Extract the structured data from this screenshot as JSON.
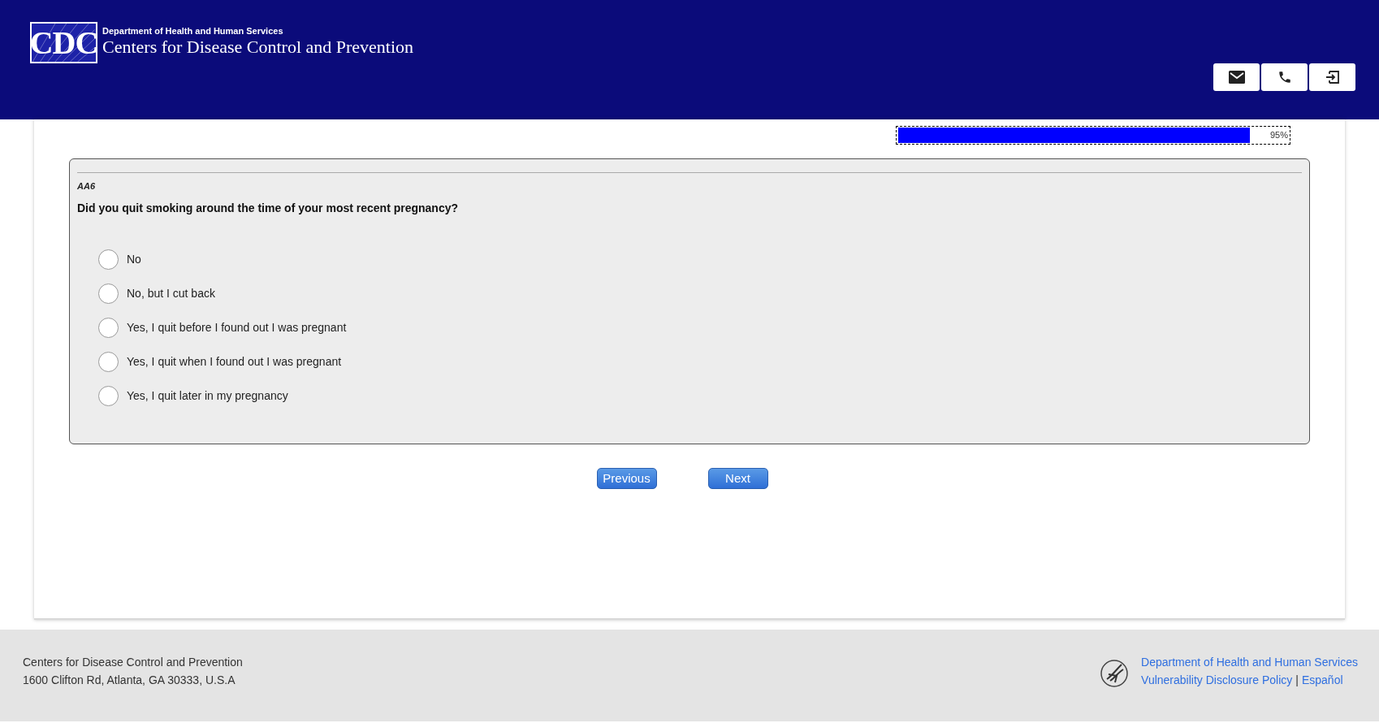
{
  "header": {
    "logo_text": "CDC",
    "department": "Department of Health and Human Services",
    "agency": "Centers for Disease Control and Prevention",
    "actions": [
      {
        "kind": "mail"
      },
      {
        "kind": "phone"
      },
      {
        "kind": "exit"
      }
    ]
  },
  "progress": {
    "level": 0.95,
    "reading": "95%"
  },
  "question": {
    "code": "AA6",
    "text": "Did you quit smoking around the time of your most recent pregnancy?",
    "options": [
      {
        "label": "No",
        "selected": false
      },
      {
        "label": "No, but I cut back",
        "selected": false
      },
      {
        "label": "Yes, I quit before I found out I was pregnant",
        "selected": false
      },
      {
        "label": "Yes, I quit when I found out I was pregnant",
        "selected": false
      },
      {
        "label": "Yes, I quit later in my pregnancy",
        "selected": false
      }
    ]
  },
  "navigation": [
    "Previous",
    "Next"
  ],
  "footer": {
    "address": [
      "Centers for Disease Control and Prevention",
      "1600 Clifton Rd, Atlanta, GA 30333, U.S.A"
    ],
    "links": [
      "Department of Health and Human Services",
      "Vulnerability Disclosure Policy",
      "Español"
    ],
    "separator": "|"
  }
}
